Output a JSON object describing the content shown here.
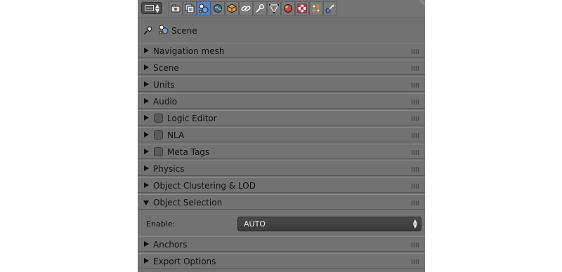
{
  "header": {
    "editor_type_icon": "properties-editor-icon",
    "context_tabs": [
      {
        "name": "render-tab",
        "icon": "camera-icon",
        "active": false
      },
      {
        "name": "render-layers-tab",
        "icon": "render-layers-icon",
        "active": false
      },
      {
        "name": "scene-tab",
        "icon": "scene-icon",
        "active": true
      },
      {
        "name": "world-tab",
        "icon": "world-icon",
        "active": false
      },
      {
        "name": "object-tab",
        "icon": "object-cube-icon",
        "active": false
      },
      {
        "name": "constraints-tab",
        "icon": "constraint-link-icon",
        "active": false
      },
      {
        "name": "modifiers-tab",
        "icon": "wrench-icon",
        "active": false
      },
      {
        "name": "data-tab",
        "icon": "mesh-data-icon",
        "active": false
      },
      {
        "name": "material-tab",
        "icon": "material-sphere-icon",
        "active": false
      },
      {
        "name": "texture-tab",
        "icon": "texture-checker-icon",
        "active": false
      },
      {
        "name": "particles-tab",
        "icon": "particles-icon",
        "active": false
      },
      {
        "name": "physics-tab",
        "icon": "physics-icon",
        "active": false
      }
    ]
  },
  "context": {
    "pin_icon": "pin-icon",
    "scene_icon": "scene-icon",
    "label": "Scene"
  },
  "panels": [
    {
      "label": "Navigation mesh",
      "checkbox": false,
      "open": false
    },
    {
      "label": "Scene",
      "checkbox": false,
      "open": false
    },
    {
      "label": "Units",
      "checkbox": false,
      "open": false
    },
    {
      "label": "Audio",
      "checkbox": false,
      "open": false
    },
    {
      "label": "Logic Editor",
      "checkbox": true,
      "checked": false,
      "open": false
    },
    {
      "label": "NLA",
      "checkbox": true,
      "checked": false,
      "open": false
    },
    {
      "label": "Meta Tags",
      "checkbox": true,
      "checked": false,
      "open": false
    },
    {
      "label": "Physics",
      "checkbox": false,
      "open": false
    },
    {
      "label": "Object Clustering & LOD",
      "checkbox": false,
      "open": false
    },
    {
      "label": "Object Selection",
      "checkbox": false,
      "open": true
    },
    {
      "label": "Anchors",
      "checkbox": false,
      "open": false
    },
    {
      "label": "Export Options",
      "checkbox": false,
      "open": false
    }
  ],
  "object_selection": {
    "enable_label": "Enable:",
    "enable_value": "AUTO"
  },
  "colors": {
    "panel_bg": "#727272",
    "active_tab": "#5680c2",
    "text": "#111111"
  }
}
